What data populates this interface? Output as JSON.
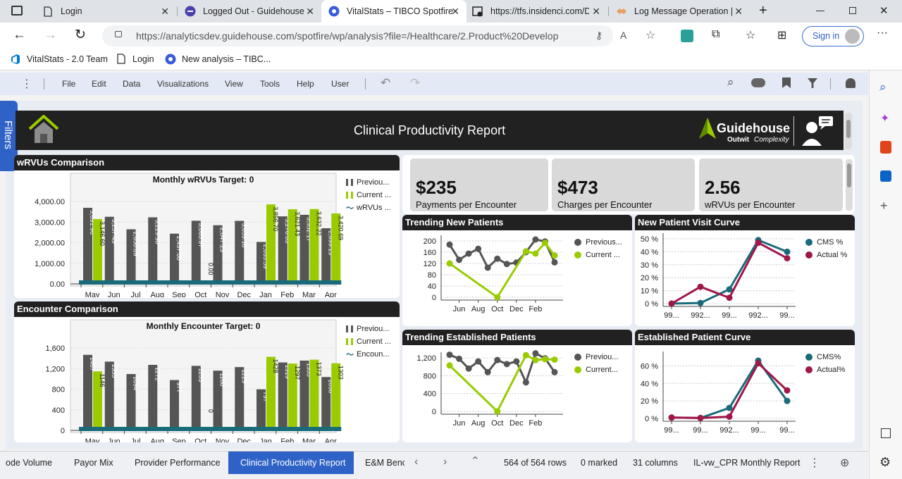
{
  "browser": {
    "tabs": [
      {
        "title": "Login"
      },
      {
        "title": "Logged Out - Guidehouse"
      },
      {
        "title": "VitalStats – TIBCO Spotfire"
      },
      {
        "title": "https://tfs.insidenci.com/D"
      },
      {
        "title": "Log Message Operation |"
      }
    ],
    "url": "https://analyticsdev.guidehouse.com/spotfire/wp/analysis?file=/Healthcare/2.Product%20Developmen...",
    "sign_in": "Sign in",
    "bookmarks": [
      "VitalStats - 2.0 Team",
      "Login",
      "New analysis – TIBC..."
    ]
  },
  "spotfire": {
    "menu": [
      "File",
      "Edit",
      "Data",
      "Visualizations",
      "View",
      "Tools",
      "Help",
      "User"
    ],
    "filters_label": "Filters",
    "report_title": "Clinical Productivity Report",
    "brand": "Guidehouse",
    "tagline_a": "Outwit",
    "tagline_b": "Complexity",
    "kpis": [
      {
        "value": "$235",
        "label": "Payments per Encounter"
      },
      {
        "value": "$473",
        "label": "Charges per Encounter"
      },
      {
        "value": "2.56",
        "label": "wRVUs per Encounter"
      }
    ],
    "bottom_tabs": [
      "ode Volume",
      "Payor Mix",
      "Provider Performance",
      "Clinical Productivity Report",
      "E&M Benc"
    ],
    "status": {
      "rows": "564 of 564 rows",
      "marked": "0 marked",
      "columns": "31 columns",
      "table": "IL-vw_CPR Monthly Report"
    }
  },
  "colors": {
    "prev": "#555555",
    "current": "#99cc00",
    "teal": "#1a6b7a",
    "crimson": "#a0174a",
    "accent": "#2f62c7"
  },
  "chart_data": [
    {
      "id": "wrvu",
      "type": "bar",
      "title": "wRVUs Comparison",
      "subtitle": "Monthly wRVUs Target: 0",
      "categories": [
        "May",
        "Jun",
        "Jul",
        "Aug",
        "Sep",
        "Oct",
        "Nov",
        "Dec",
        "Jan",
        "Feb",
        "Mar",
        "Apr"
      ],
      "series": [
        {
          "name": "Previou...",
          "values": [
            3691.96,
            3257.49,
            2650.09,
            3229.9,
            2437.0,
            3063.97,
            2847.23,
            3059.18,
            2035.59,
            3276.03,
            3352.17,
            2699.13
          ]
        },
        {
          "name": "Current ...",
          "values": [
            3146.6,
            null,
            null,
            null,
            null,
            0.0,
            null,
            null,
            3856.7,
            3621.43,
            3632.22,
            3420.69
          ]
        }
      ],
      "line_series": "wRVUs ...",
      "yticks": [
        "4,000.00",
        "3,000.00",
        "2,000.00",
        "1,000.00",
        "0.00"
      ],
      "ylim": [
        0,
        4000
      ]
    },
    {
      "id": "enc",
      "type": "bar",
      "title": "Encounter Comparison",
      "subtitle": "Monthly Encounter Target: 0",
      "categories": [
        "May",
        "Jun",
        "Jul",
        "Aug",
        "Sep",
        "Oct",
        "Nov",
        "Dec",
        "Jan",
        "Feb",
        "Mar",
        "Apr"
      ],
      "series": [
        {
          "name": "Previou...",
          "values": [
            1467,
            1335,
            1094,
            1272,
            977,
            1253,
            1160,
            1229,
            797,
            1319,
            1355,
            1036
          ]
        },
        {
          "name": "Current ...",
          "values": [
            1146,
            null,
            null,
            null,
            null,
            0,
            null,
            null,
            1428,
            1297,
            1373,
            1303
          ]
        }
      ],
      "line_series": "Encoun...",
      "yticks": [
        "1,600",
        "1,200",
        "800",
        "400",
        "0"
      ],
      "ylim": [
        0,
        1600
      ]
    },
    {
      "id": "newpat",
      "type": "line",
      "title": "Trending New Patients",
      "x": [
        "Jun",
        "Aug",
        "Oct",
        "Dec",
        "Feb"
      ],
      "yticks": [
        "200",
        "160",
        "120",
        "80",
        "40",
        "0"
      ],
      "ylim": [
        0,
        200
      ],
      "series": [
        {
          "name": "Previous...",
          "values": [
            187,
            133,
            155,
            172,
            105,
            137,
            118,
            123,
            160,
            205,
            198,
            124
          ]
        },
        {
          "name": "Current ...",
          "values": [
            120,
            null,
            null,
            null,
            null,
            0,
            null,
            null,
            163,
            155,
            193,
            148
          ]
        }
      ]
    },
    {
      "id": "estpat",
      "type": "line",
      "title": "Trending Established Patients",
      "x": [
        "Jun",
        "Aug",
        "Oct",
        "Dec",
        "Feb"
      ],
      "yticks": [
        "1,200",
        "800",
        "400",
        "0"
      ],
      "ylim": [
        0,
        1200
      ],
      "series": [
        {
          "name": "Previou...",
          "values": [
            1270,
            1180,
            960,
            1120,
            880,
            1150,
            1060,
            1120,
            650,
            1300,
            1190,
            880
          ]
        },
        {
          "name": "Current...",
          "values": [
            1030,
            null,
            null,
            null,
            null,
            0,
            null,
            null,
            1260,
            1150,
            1170,
            1160
          ]
        }
      ]
    },
    {
      "id": "newcurve",
      "type": "line",
      "title": "New Patient Visit Curve",
      "x": [
        "99...",
        "992...",
        "99...",
        "992...",
        "99..."
      ],
      "yticks": [
        "50 %",
        "40 %",
        "30 %",
        "20 %",
        "10 %",
        "0 %"
      ],
      "ylim": [
        0,
        50
      ],
      "series": [
        {
          "name": "CMS %",
          "values": [
            0,
            0.5,
            11,
            49,
            40
          ]
        },
        {
          "name": "Actual %",
          "values": [
            0,
            13,
            4.5,
            47,
            35
          ]
        }
      ]
    },
    {
      "id": "estcurve",
      "type": "line",
      "title": "Established Patient Curve",
      "x": [
        "99...",
        "99...",
        "992...",
        "99...",
        "99..."
      ],
      "yticks": [
        "60 %",
        "40 %",
        "20 %",
        "0 %"
      ],
      "ylim": [
        0,
        70
      ],
      "series": [
        {
          "name": "CMS%",
          "values": [
            1,
            0.5,
            12,
            66,
            20
          ]
        },
        {
          "name": "Actual%",
          "values": [
            1,
            0.5,
            2,
            63,
            32
          ]
        }
      ]
    }
  ]
}
